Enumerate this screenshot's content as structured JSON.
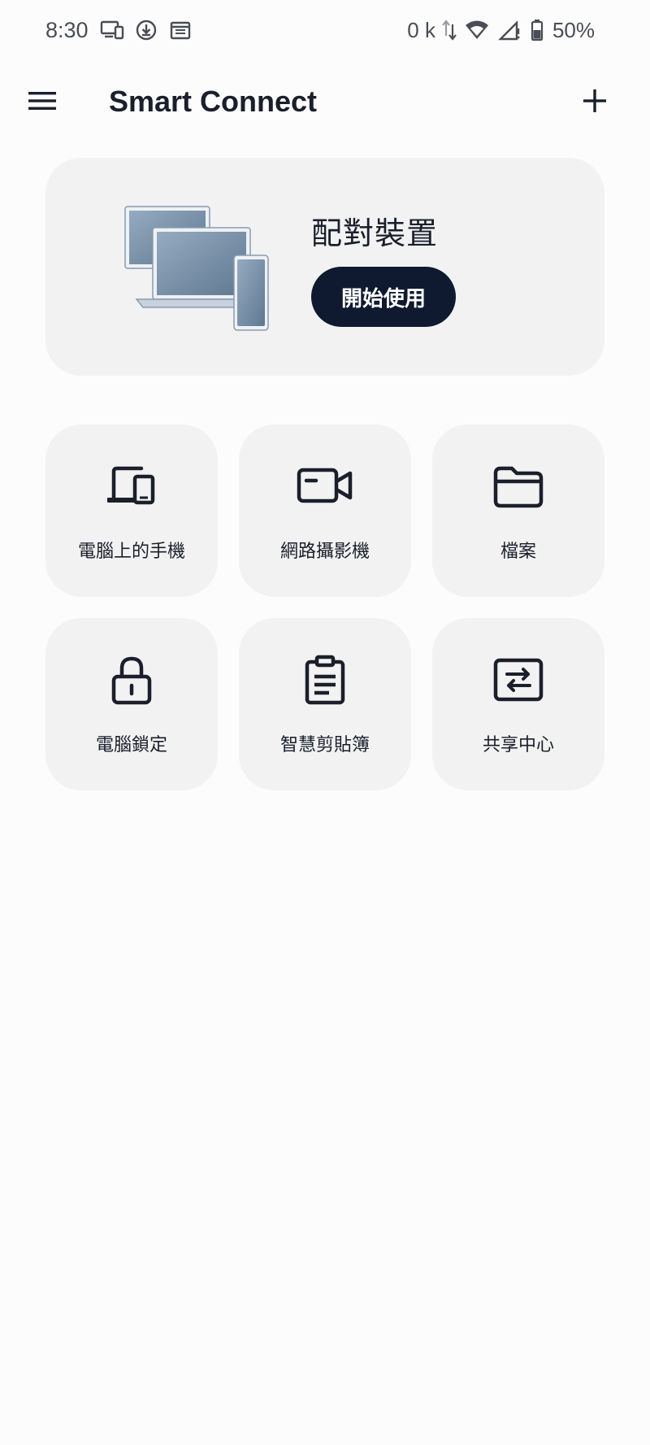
{
  "status_bar": {
    "time": "8:30",
    "net_speed": "0 k",
    "battery": "50%",
    "left_icons": [
      "screen-mirror-icon",
      "download-progress-icon",
      "calendar-icon"
    ],
    "right_icons": [
      "data-transfer-icon",
      "wifi-icon",
      "cell-signal-icon",
      "battery-icon"
    ]
  },
  "app_bar": {
    "title": "Smart Connect",
    "menu_icon": "hamburger-menu-icon",
    "add_icon": "plus-icon"
  },
  "pair_card": {
    "title": "配對裝置",
    "button_label": "開始使用",
    "illustration": "devices-illustration"
  },
  "features": [
    {
      "label": "電腦上的手機",
      "icon": "phone-on-pc-icon"
    },
    {
      "label": "網路攝影機",
      "icon": "webcam-icon"
    },
    {
      "label": "檔案",
      "icon": "folder-icon"
    },
    {
      "label": "電腦鎖定",
      "icon": "lock-icon"
    },
    {
      "label": "智慧剪貼簿",
      "icon": "clipboard-icon"
    },
    {
      "label": "共享中心",
      "icon": "share-center-icon"
    }
  ],
  "colors": {
    "background": "#fcfcfc",
    "card": "#f2f2f2",
    "primary_button": "#0f1a30",
    "text": "#1b1f2b",
    "status_text": "#4a4d55"
  }
}
